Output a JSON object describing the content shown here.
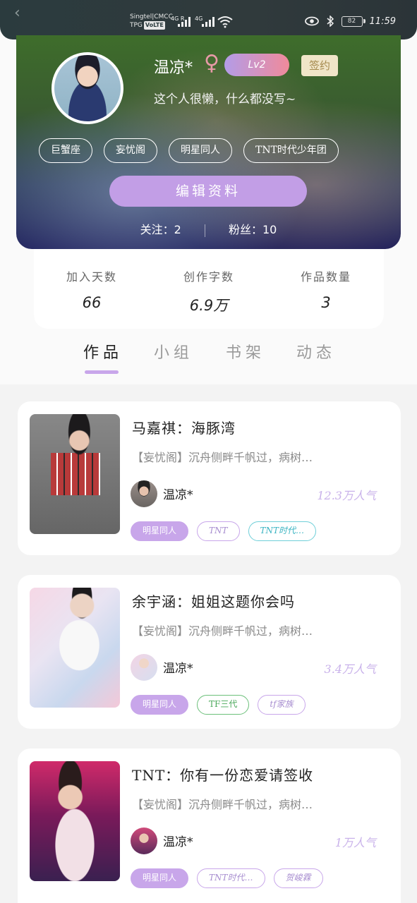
{
  "status_bar": {
    "carrier_line1": "Singtel|CMCC",
    "carrier_line2": "TPG",
    "volte": "VoLTE",
    "sig1_label": "4G R",
    "sig2_label": "4G",
    "battery": "82",
    "time": "11:59"
  },
  "profile": {
    "username": "温凉*",
    "gender_symbol": "♀",
    "level": "Lv2",
    "signed": "签约",
    "bio": "这个人很懒，什么都没写~",
    "tags": [
      "巨蟹座",
      "妄忧阁",
      "明星同人",
      "TNT时代少年团"
    ],
    "edit_label": "编辑资料",
    "following_label": "关注：2",
    "followers_label": "粉丝：10"
  },
  "stats": [
    {
      "label": "加入天数",
      "value": "66"
    },
    {
      "label": "创作字数",
      "value": "6.9万"
    },
    {
      "label": "作品数量",
      "value": "3"
    }
  ],
  "tabs": [
    "作品",
    "小组",
    "书架",
    "动态"
  ],
  "works": [
    {
      "title": "马嘉祺：海豚湾",
      "summary": "【妄忧阁】沉舟侧畔千帆过，病树…",
      "author": "温凉*",
      "popularity": "12.3万人气",
      "tags": [
        {
          "label": "明星同人",
          "style": "filled"
        },
        {
          "label": "TNT",
          "style": "purple"
        },
        {
          "label": "TNT时代…",
          "style": "teal"
        }
      ]
    },
    {
      "title": "余宇涵：姐姐这题你会吗",
      "summary": "【妄忧阁】沉舟侧畔千帆过，病树…",
      "author": "温凉*",
      "popularity": "3.4万人气",
      "tags": [
        {
          "label": "明星同人",
          "style": "filled"
        },
        {
          "label": "TF三代",
          "style": "green"
        },
        {
          "label": "tf家族",
          "style": "purple"
        }
      ]
    },
    {
      "title": "TNT：你有一份恋爱请签收",
      "summary": "【妄忧阁】沉舟侧畔千帆过，病树…",
      "author": "温凉*",
      "popularity": "1万人气",
      "tags": [
        {
          "label": "明星同人",
          "style": "filled"
        },
        {
          "label": "TNT时代…",
          "style": "purple"
        },
        {
          "label": "贺峻霖",
          "style": "purple"
        }
      ]
    }
  ]
}
